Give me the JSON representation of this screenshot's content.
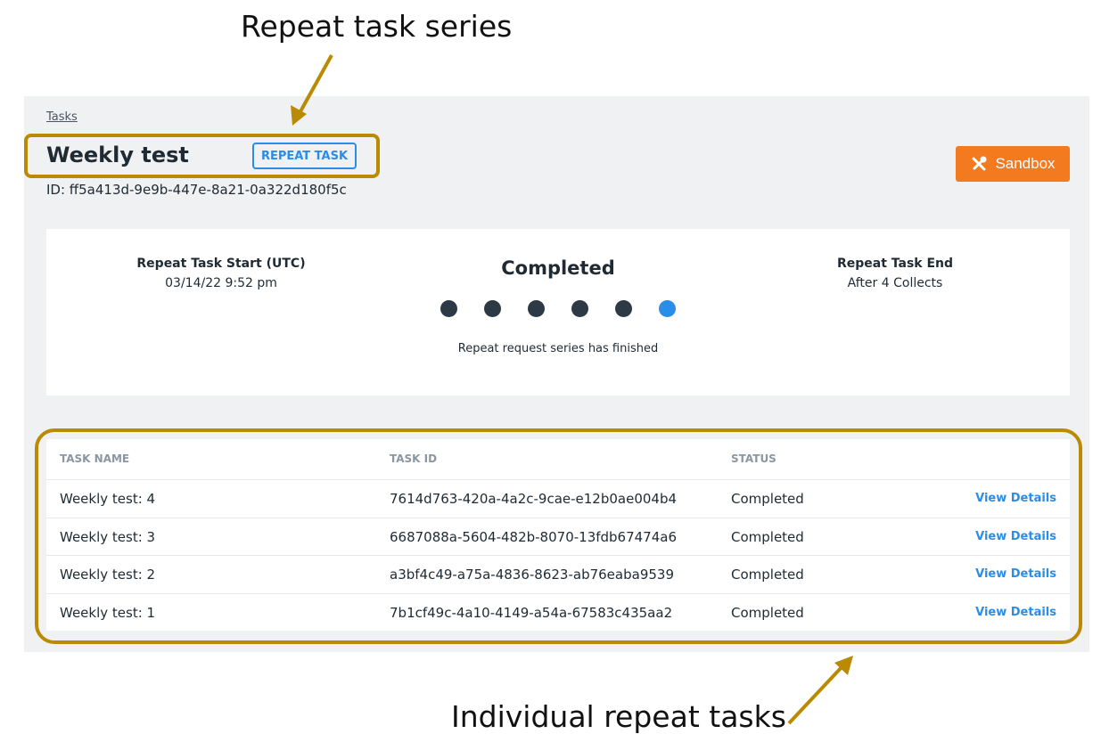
{
  "annotations": {
    "top": "Repeat task series",
    "bottom": "Individual repeat tasks",
    "color": "#bb8a03"
  },
  "breadcrumb": "Tasks",
  "header": {
    "title": "Weekly test",
    "badge": "REPEAT TASK",
    "id": "ID: ff5a413d-9e9b-447e-8a21-0a322d180f5c",
    "sandbox_label": "Sandbox",
    "sandbox_icon": "tools-icon"
  },
  "summary": {
    "start_label": "Repeat Task Start (UTC)",
    "start_value": "03/14/22 9:52 pm",
    "status": "Completed",
    "status_note": "Repeat request series has finished",
    "end_label": "Repeat Task End",
    "end_value": "After 4 Collects",
    "steps_total": 6,
    "current_step": 6
  },
  "table": {
    "headers": [
      "TASK NAME",
      "TASK ID",
      "STATUS"
    ],
    "rows": [
      {
        "name": "Weekly test: 4",
        "id": "7614d763-420a-4a2c-9cae-e12b0ae004b4",
        "status": "Completed",
        "action": "View Details"
      },
      {
        "name": "Weekly test: 3",
        "id": "6687088a-5604-482b-8070-13fdb67474a6",
        "status": "Completed",
        "action": "View Details"
      },
      {
        "name": "Weekly test: 2",
        "id": "a3bf4c49-a75a-4836-8623-ab76eaba9539",
        "status": "Completed",
        "action": "View Details"
      },
      {
        "name": "Weekly test: 1",
        "id": "7b1cf49c-4a10-4149-a54a-67583c435aa2",
        "status": "Completed",
        "action": "View Details"
      }
    ]
  },
  "colors": {
    "accent": "#2a8de8",
    "sandbox": "#f47a1f",
    "dot": "#2d3a45"
  }
}
